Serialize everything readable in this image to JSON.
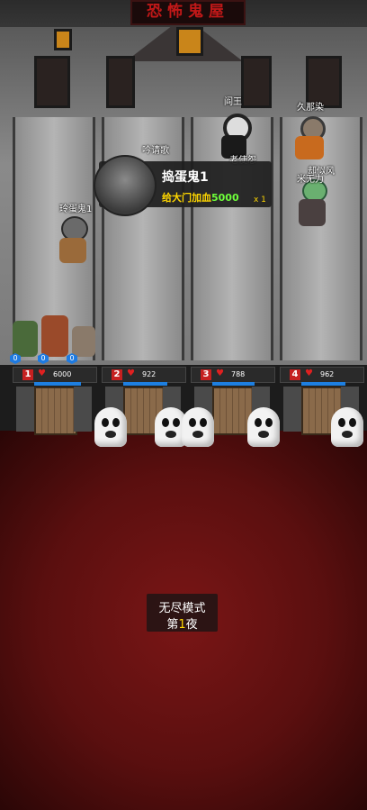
{
  "title": "恐怖鬼屋",
  "characters": [
    {
      "name": "阎王"
    },
    {
      "name": "久那染"
    },
    {
      "name": "吟请歌"
    },
    {
      "name": "版主"
    },
    {
      "name": "老使怨"
    },
    {
      "name": "却似风"
    },
    {
      "name": "米无力"
    },
    {
      "name": "玲蛋鬼1"
    }
  ],
  "tooltip": {
    "name": "捣蛋鬼1",
    "desc_prefix": "给大门加血",
    "desc_value": "5000",
    "multiplier": "x 1"
  },
  "badges": [
    "0",
    "0",
    "0"
  ],
  "gates": [
    {
      "number": "1",
      "hp": "6000",
      "hp_fraction": 1.0
    },
    {
      "number": "2",
      "hp": "922",
      "hp_fraction": 0.95
    },
    {
      "number": "3",
      "hp": "788",
      "hp_fraction": 0.9
    },
    {
      "number": "4",
      "hp": "962",
      "hp_fraction": 0.95
    }
  ],
  "mode": {
    "title": "无尽模式",
    "night_prefix": "第",
    "night_number": "1",
    "night_suffix": "夜"
  },
  "colors": {
    "title": "#c01818",
    "gate_number_bg": "#c62020",
    "hp_bar": "#1e7fe0",
    "highlight_gold": "#ffd700",
    "highlight_green": "#6eff3a",
    "floor": "#7a1616"
  }
}
